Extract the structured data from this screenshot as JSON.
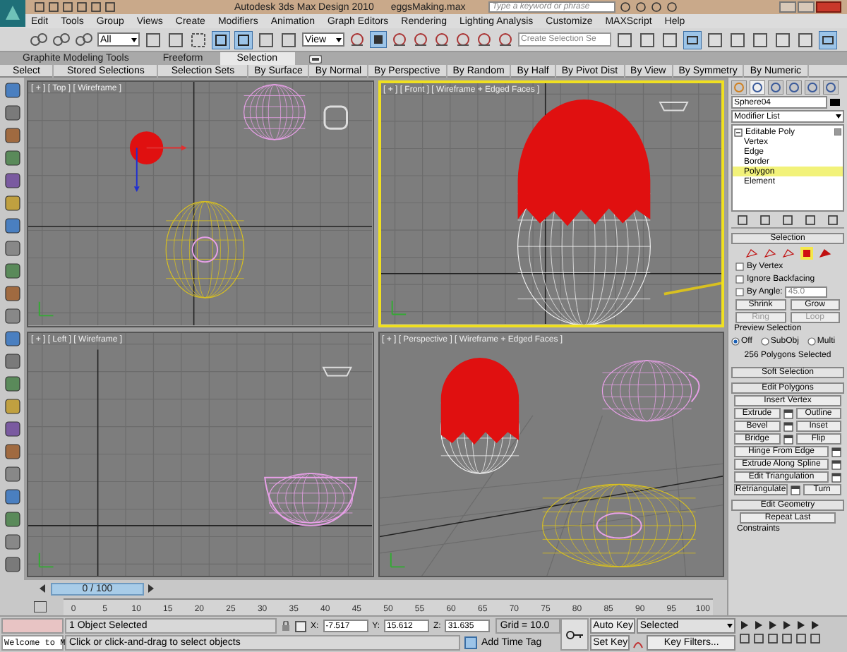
{
  "window": {
    "title": "Autodesk 3ds Max Design 2010",
    "file": "eggsMaking.max",
    "search_placeholder": "Type a keyword or phrase"
  },
  "menu": [
    "Edit",
    "Tools",
    "Group",
    "Views",
    "Create",
    "Modifiers",
    "Animation",
    "Graph Editors",
    "Rendering",
    "Lighting Analysis",
    "Customize",
    "MAXScript",
    "Help"
  ],
  "toolbar": {
    "filter": "All",
    "reference": "View",
    "selection_set_placeholder": "Create Selection Se"
  },
  "ribbon_tabs": [
    {
      "label": "Graphite Modeling Tools",
      "selected": false
    },
    {
      "label": "Freeform",
      "selected": false
    },
    {
      "label": "Selection",
      "selected": true
    }
  ],
  "ribbon_panels": [
    "Select",
    "Stored Selections",
    "Selection Sets",
    "By Surface",
    "By Normal",
    "By Perspective",
    "By Random",
    "By Half",
    "By Pivot Dist",
    "By View",
    "By Symmetry",
    "By Numeric"
  ],
  "viewports": [
    {
      "label": "[ + ] [ Top ] [ Wireframe ]",
      "active": false
    },
    {
      "label": "[ + ] [ Front ] [ Wireframe + Edged Faces ]",
      "active": true
    },
    {
      "label": "[ + ] [ Left ] [ Wireframe ]",
      "active": false
    },
    {
      "label": "[ + ] [ Perspective ] [ Wireframe + Edged Faces ]",
      "active": false
    }
  ],
  "command_panel": {
    "object_name": "Sphere04",
    "modifier_list": "Modifier List",
    "stack": [
      {
        "label": "Editable Poly",
        "expanded": true,
        "children": [
          {
            "label": "Vertex",
            "selected": false
          },
          {
            "label": "Edge",
            "selected": false
          },
          {
            "label": "Border",
            "selected": false
          },
          {
            "label": "Polygon",
            "selected": true
          },
          {
            "label": "Element",
            "selected": false
          }
        ]
      }
    ],
    "selection": {
      "title": "Selection",
      "checkboxes": [
        {
          "label": "By Vertex",
          "checked": false
        },
        {
          "label": "Ignore Backfacing",
          "checked": false
        },
        {
          "label": "By Angle:",
          "checked": false,
          "value": "45.0"
        }
      ],
      "buttons": [
        {
          "label": "Shrink",
          "disabled": false
        },
        {
          "label": "Grow",
          "disabled": false
        },
        {
          "label": "Ring",
          "disabled": true
        },
        {
          "label": "Loop",
          "disabled": true
        }
      ],
      "preview_label": "Preview Selection",
      "preview_options": [
        {
          "label": "Off",
          "selected": true
        },
        {
          "label": "SubObj",
          "selected": false
        },
        {
          "label": "Multi",
          "selected": false
        }
      ],
      "count": "256 Polygons Selected"
    },
    "rollouts": [
      "Soft Selection",
      "Edit Polygons"
    ],
    "edit_polygons": [
      [
        "Insert Vertex"
      ],
      [
        "Extrude",
        "Outline"
      ],
      [
        "Bevel",
        "Inset"
      ],
      [
        "Bridge",
        "Flip"
      ],
      [
        "Hinge From Edge"
      ],
      [
        "Extrude Along Spline"
      ],
      [
        "Edit Triangulation"
      ],
      [
        "Retriangulate",
        "Turn"
      ]
    ],
    "edit_geometry": {
      "title": "Edit Geometry",
      "button": "Repeat Last",
      "label": "Constraints"
    }
  },
  "timeline": {
    "frame": "0 / 100",
    "ticks": [
      "0",
      "5",
      "10",
      "15",
      "20",
      "25",
      "30",
      "35",
      "40",
      "45",
      "50",
      "55",
      "60",
      "65",
      "70",
      "75",
      "80",
      "85",
      "90",
      "95",
      "100"
    ]
  },
  "status": {
    "listener": "Welcome to M",
    "selection": "1 Object Selected",
    "prompt": "Click or click-and-drag to select objects",
    "coordinates": [
      {
        "label": "X:",
        "value": "-7.517"
      },
      {
        "label": "Y:",
        "value": "15.612"
      },
      {
        "label": "Z:",
        "value": "31.635"
      }
    ],
    "grid": "Grid = 10.0",
    "time_tag": "Add Time Tag",
    "auto_key": "Auto Key",
    "key_mode": "Selected",
    "set_key": "Set Key",
    "key_filters": "Key Filters..."
  }
}
